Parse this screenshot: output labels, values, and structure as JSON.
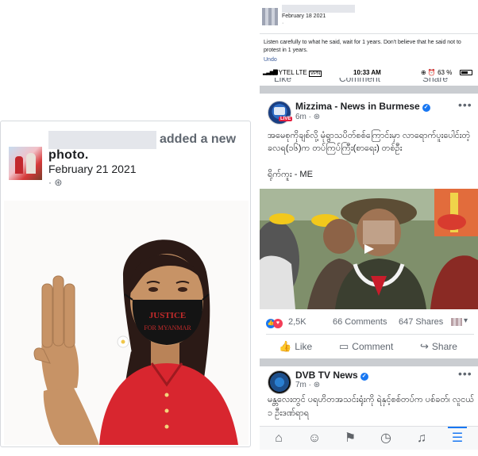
{
  "left_post": {
    "action": "added a new",
    "photo_word": "photo.",
    "date": "February 21 2021",
    "meta": "· ⊛",
    "image_text_line1": "JUSTICE",
    "image_text_line2": "FOR MYANMAR"
  },
  "top_post": {
    "date": "February 18 2021",
    "dot": "·",
    "comment": "Listen carefully to what he said, wait for 1 years. Don't believe that he said not to protest in 1 years.",
    "undo": "Undo"
  },
  "status_bar": {
    "signal": "▂▃▅▇",
    "carrier": "MYTEL  LTE",
    "vpn": "VPN",
    "time": "10:33 AM",
    "icons": "⊕ ⏰ 63 %",
    "battery_level": 0.63
  },
  "cut_actions": {
    "like": "Like",
    "comment": "Comment",
    "share": "Share"
  },
  "post1": {
    "page_name": "Mizzima - News in Burmese",
    "live": "LIVE",
    "time": "6m · ⊛",
    "text": "အမေစုကိုချစ်လို့ မုံရွာသပိတ်စစ်ကြောင်းမှာ လာရောက်ပူးပေါင်းတဲ့ ခလရ(၁၆)က တပ်ကြပ်ကြီး(စာရေး) တစ်ဦး",
    "location": "ရိုက်ကူး - ME",
    "reaction_count": "2,5K",
    "comments": "66 Comments",
    "shares": "647 Shares",
    "like_label": "Like",
    "comment_label": "Comment",
    "share_label": "Share"
  },
  "post2": {
    "page_name": "DVB TV News",
    "time": "7m · ⊛",
    "text": "မန္တလေးတွင် ပရဟိတအသင်းရုံးကို ရဲနှင့်စစ်တပ်က ပစ်ခတ်၊ လူငယ် ၁ ဦးဒဏ်ရာရ"
  },
  "bottom_nav": [
    "home-icon",
    "groups-icon",
    "flag-icon",
    "clock-icon",
    "bell-icon",
    "menu-icon"
  ]
}
